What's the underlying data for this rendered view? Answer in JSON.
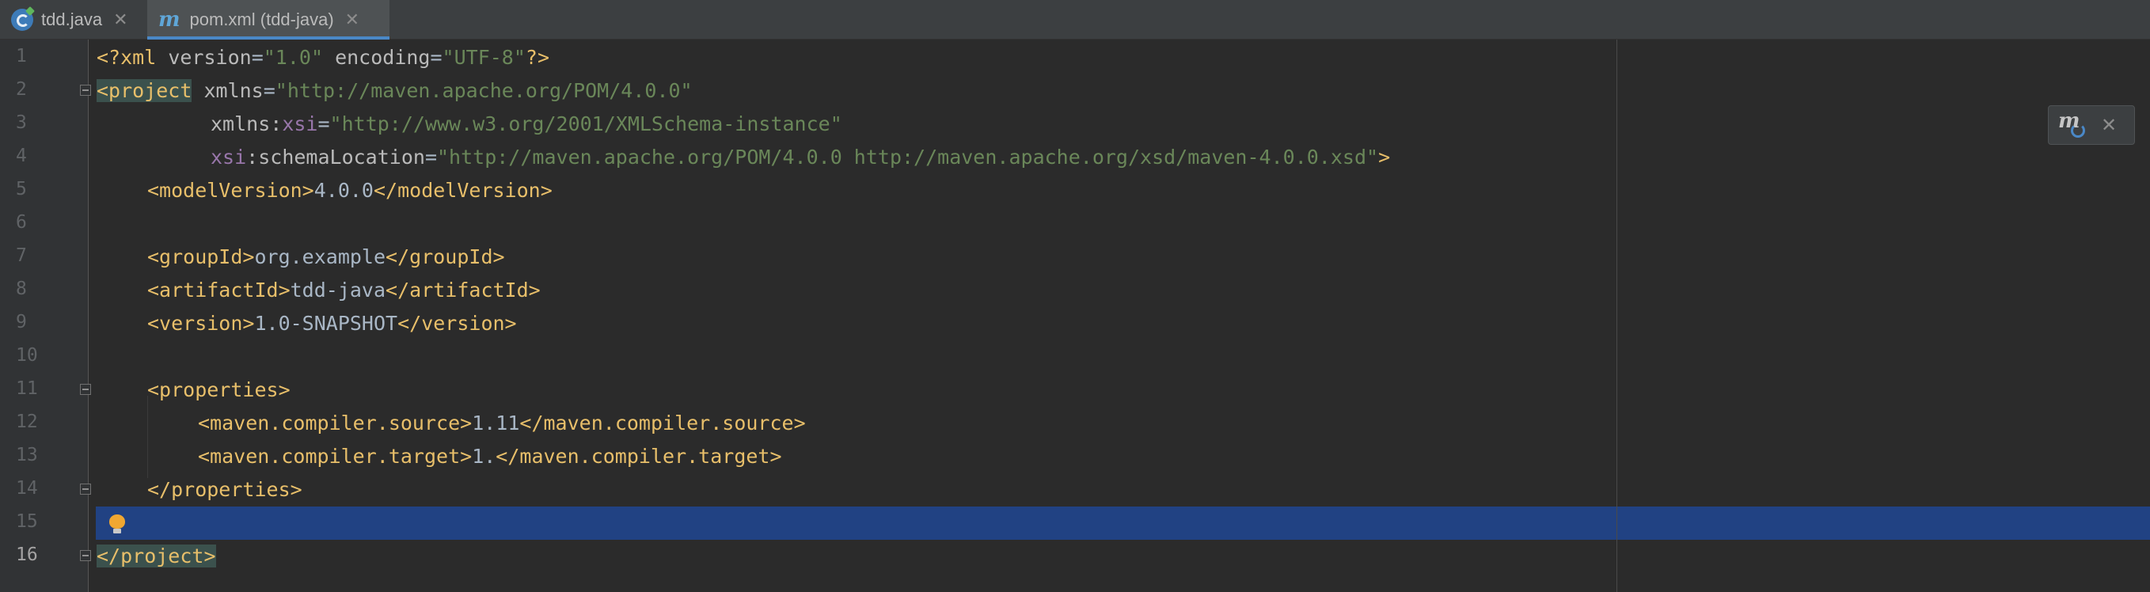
{
  "tabs": [
    {
      "label": "tdd.java",
      "icon": "java-class-icon"
    },
    {
      "label": "pom.xml (tdd-java)",
      "icon": "maven-icon",
      "active": true
    }
  ],
  "tab_close_glyph": "✕",
  "gutter": {
    "line_numbers": [
      "1",
      "2",
      "3",
      "4",
      "5",
      "6",
      "7",
      "8",
      "9",
      "10",
      "11",
      "12",
      "13",
      "14",
      "15",
      "16"
    ],
    "current_line": "16"
  },
  "code": {
    "l1": {
      "open": "<?xml",
      "attr_version": " version",
      "eq": "=",
      "v1": "\"1.0\"",
      "attr_enc": " encoding",
      "v2": "\"UTF-8\"",
      "close": "?>"
    },
    "l2": {
      "tag": "<project",
      "attr": " xmlns",
      "eq": "=",
      "val": "\"http://maven.apache.org/POM/4.0.0\""
    },
    "l3": {
      "attr": "xmlns",
      "colon": ":",
      "ns": "xsi",
      "eq": "=",
      "val": "\"http://www.w3.org/2001/XMLSchema-instance\""
    },
    "l4": {
      "ns": "xsi",
      "colon": ":",
      "attr": "schemaLocation",
      "eq": "=",
      "val": "\"http://maven.apache.org/POM/4.0.0 http://maven.apache.org/xsd/maven-4.0.0.xsd\"",
      "close": ">"
    },
    "l5": {
      "open": "<modelVersion>",
      "text": "4.0.0",
      "close": "</modelVersion>"
    },
    "l7": {
      "open": "<groupId>",
      "text": "org.example",
      "close": "</groupId>"
    },
    "l8": {
      "open": "<artifactId>",
      "text": "tdd-java",
      "close": "</artifactId>"
    },
    "l9": {
      "open": "<version>",
      "text": "1.0-SNAPSHOT",
      "close": "</version>"
    },
    "l11": {
      "open": "<properties>"
    },
    "l12": {
      "open": "<maven.compiler.source>",
      "text": "1.11",
      "close": "</maven.compiler.source>"
    },
    "l13": {
      "open": "<maven.compiler.target>",
      "text": "1.",
      "close": "</maven.compiler.target>"
    },
    "l14": {
      "close": "</properties>"
    },
    "l16": {
      "close": "</project>"
    }
  },
  "colors": {
    "background": "#2b2b2b",
    "tag": "#e8bf6a",
    "attribute_value": "#6a8759",
    "namespace": "#9876aa",
    "caret_row": "#214283",
    "accent": "#4a88c7"
  },
  "maven_popup": {
    "icon": "maven-reload-icon",
    "close_glyph": "✕"
  }
}
